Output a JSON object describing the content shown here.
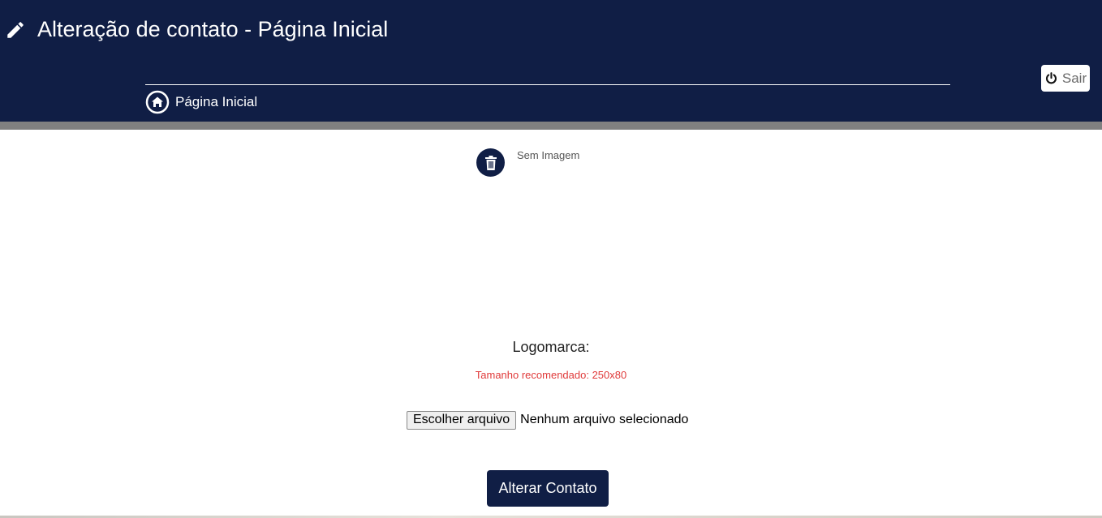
{
  "header": {
    "title": "Alteração de contato - Página Inicial",
    "title_icon": "pencil-icon",
    "breadcrumb": {
      "label": "Página Inicial",
      "icon": "home-icon"
    },
    "logout": {
      "label": "Sair",
      "icon": "power-icon"
    }
  },
  "image_preview": {
    "delete_icon": "trash-icon",
    "placeholder_text": "Sem Imagem"
  },
  "form": {
    "logo_label": "Logomarca:",
    "recommended_size": "Tamanho recomendado: 250x80",
    "file_button_label": "Escolher arquivo",
    "file_status": "Nenhum arquivo selecionado",
    "submit_label": "Alterar Contato"
  },
  "colors": {
    "header_background": "#101e45",
    "separator_bar": "#808080",
    "warning_text": "#e03a3a",
    "primary_button": "#101e45"
  }
}
